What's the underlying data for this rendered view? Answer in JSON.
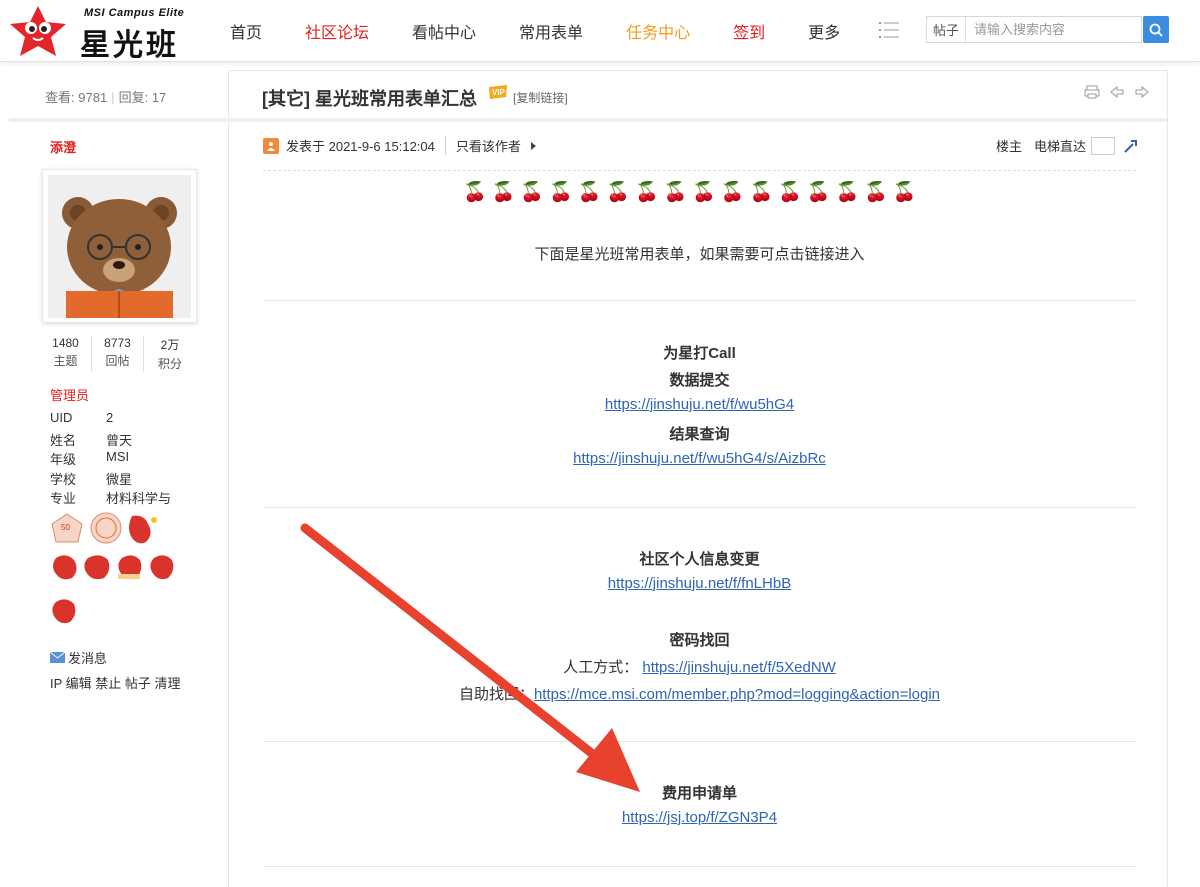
{
  "header": {
    "logo_sub": "MSI Campus Elite",
    "logo_main": "星光班",
    "nav": [
      "首页",
      "社区论坛",
      "看帖中心",
      "常用表单",
      "任务中心",
      "签到",
      "更多"
    ],
    "search_type": "帖子",
    "search_placeholder": "请输入搜索内容"
  },
  "colors": {
    "brand_red": "#e02020",
    "accent_orange": "#f39b1b",
    "link_blue": "#2d64b3",
    "search_blue": "#3b8ddd",
    "arrow_red": "#e8412d"
  },
  "thread": {
    "views_label": "查看:",
    "views": "9781",
    "replies_label": "回复:",
    "replies": "17",
    "title": "[其它] 星光班常用表单汇总",
    "copy_link": "[复制链接]"
  },
  "user": {
    "name": "添澄",
    "stats": [
      {
        "num": "1480",
        "label": "主题"
      },
      {
        "num": "8773",
        "label": "回帖"
      },
      {
        "num": "2万",
        "label": "积分"
      }
    ],
    "role": "管理员",
    "info": [
      {
        "k": "UID",
        "v": "2"
      },
      {
        "k": "姓名",
        "v": "曾天"
      },
      {
        "k": "年级",
        "v": "MSI"
      },
      {
        "k": "学校",
        "v": "微星"
      },
      {
        "k": "专业",
        "v": "材料科学与"
      }
    ],
    "send_msg": "发消息",
    "admin_links": "IP 编辑 禁止 帖子 清理"
  },
  "post": {
    "posted_at": "发表于 2021-9-6 15:12:04",
    "author_only": "只看该作者",
    "floor": "楼主",
    "elevator": "电梯直达",
    "cherries": "🍒🍒🍒🍒🍒🍒🍒🍒🍒🍒🍒🍒🍒🍒🍒🍒",
    "intro": "下面是星光班常用表单，如果需要可点击链接进入",
    "sec1": {
      "title": "为星打Call",
      "sub1": "数据提交",
      "link1": "https://jinshuju.net/f/wu5hG4",
      "sub2": "结果查询",
      "link2": "https://jinshuju.net/f/wu5hG4/s/AizbRc"
    },
    "sec2": {
      "title": "社区个人信息变更",
      "link1": "https://jinshuju.net/f/fnLHbB",
      "sub2": "密码找回",
      "manual_label": "人工方式：",
      "manual_link": "https://jinshuju.net/f/5XedNW",
      "self_label": "自助找回：",
      "self_link": "https://mce.msi.com/member.php?mod=logging&action=login"
    },
    "sec3": {
      "title": "费用申请单",
      "link1": "https://jsj.top/f/ZGN3P4"
    }
  }
}
